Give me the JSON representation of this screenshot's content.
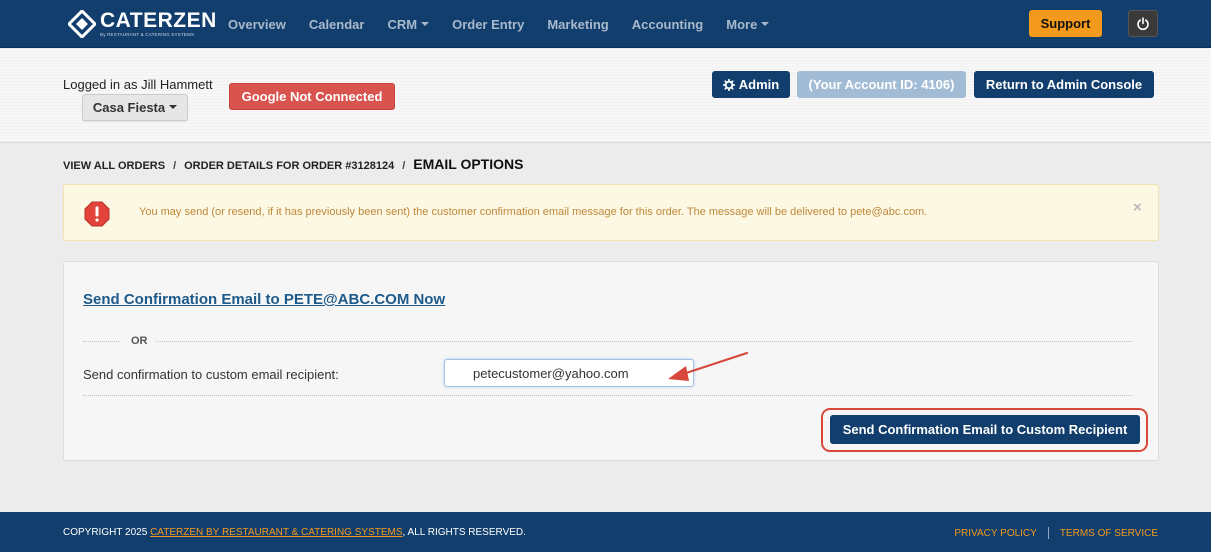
{
  "brand": {
    "name": "CATERZEN",
    "tagline": "By RESTAURANT & CATERING SYSTEMS"
  },
  "nav": {
    "items": [
      {
        "label": "Overview",
        "dropdown": false
      },
      {
        "label": "Calendar",
        "dropdown": false
      },
      {
        "label": "CRM",
        "dropdown": true
      },
      {
        "label": "Order Entry",
        "dropdown": false
      },
      {
        "label": "Marketing",
        "dropdown": false
      },
      {
        "label": "Accounting",
        "dropdown": false
      },
      {
        "label": "More",
        "dropdown": true
      }
    ],
    "support_label": "Support",
    "power_icon": "power-icon"
  },
  "account": {
    "logged_in_text": "Logged in as Jill Hammett",
    "store_name": "Casa Fiesta",
    "google_status": "Google Not Connected",
    "admin_label": "Admin",
    "admin_icon": "gear-icon",
    "account_id": "(Your Account ID: 4106)",
    "return_label": "Return to Admin Console"
  },
  "breadcrumb": {
    "items": [
      "VIEW ALL ORDERS",
      "ORDER DETAILS FOR ORDER #3128124"
    ],
    "separator": "/",
    "current": "EMAIL OPTIONS"
  },
  "alert": {
    "icon": "warning-octagon-icon",
    "message": "You may send (or resend, if it has previously been sent) the customer confirmation email message for this order. The message will be delivered to pete@abc.com.",
    "close": "×"
  },
  "panel": {
    "send_now_link": "Send Confirmation Email to PETE@ABC.COM Now",
    "or_label": "OR",
    "custom_label": "Send confirmation to custom email recipient:",
    "custom_email_value": "petecustomer@yahoo.com",
    "send_custom_label": "Send Confirmation Email to Custom Recipient"
  },
  "footer": {
    "copyright_prefix": "COPYRIGHT 2025 ",
    "copyright_brand": "CATERZEN BY RESTAURANT & CATERING SYSTEMS",
    "copyright_suffix": ", ALL RIGHTS RESERVED.",
    "privacy": "PRIVACY POLICY",
    "terms": "TERMS OF SERVICE"
  },
  "colors": {
    "navbar": "#113e6d",
    "accent_orange": "#f39a1c",
    "danger": "#d9534f",
    "alert_bg": "#fcf8e3",
    "alert_text": "#c0883a",
    "annotation_red": "#d9473b"
  }
}
